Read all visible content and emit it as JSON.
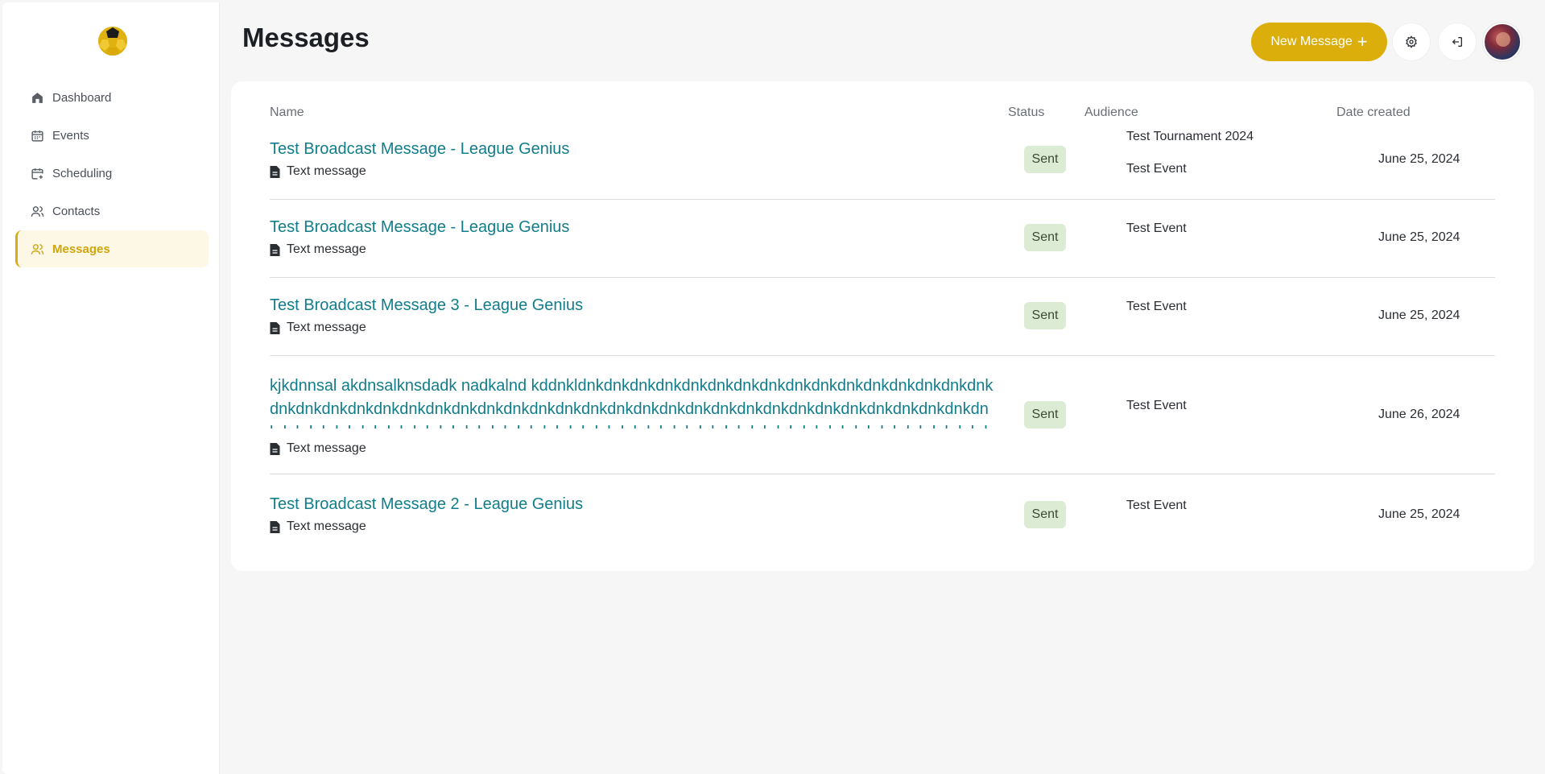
{
  "sidebar": {
    "items": [
      {
        "label": "Dashboard",
        "icon": "home-icon",
        "active": false
      },
      {
        "label": "Events",
        "icon": "calendar-icon",
        "active": false
      },
      {
        "label": "Scheduling",
        "icon": "calendar-plus-icon",
        "active": false
      },
      {
        "label": "Contacts",
        "icon": "users-icon",
        "active": false
      },
      {
        "label": "Messages",
        "icon": "users-icon",
        "active": true
      }
    ]
  },
  "header": {
    "title": "Messages",
    "new_button_label": "New Message",
    "new_button_icon": "plus-icon",
    "settings_icon": "gear-icon",
    "logout_icon": "logout-icon"
  },
  "table": {
    "columns": {
      "name": "Name",
      "status": "Status",
      "audience": "Audience",
      "date": "Date created"
    },
    "rows": [
      {
        "title": "Test Broadcast Message - League Genius",
        "type": "Text message",
        "status": "Sent",
        "audience": [
          "Test Tournament 2024",
          "Test Event"
        ],
        "date": "June 25, 2024"
      },
      {
        "title": "Test Broadcast Message - League Genius",
        "type": "Text message",
        "status": "Sent",
        "audience": [
          "Test Event"
        ],
        "date": "June 25, 2024"
      },
      {
        "title": "Test Broadcast Message 3 - League Genius",
        "type": "Text message",
        "status": "Sent",
        "audience": [
          "Test Event"
        ],
        "date": "June 25, 2024"
      },
      {
        "title": "kjkdnnsal akdnsalknsdadk nadkalnd kddnkldnkdnkdnkdnkdnkdnkdnkdnkdnkdnkdnkdnkdnkdnkdnkdnkdnkdnkdnkdnkdnkdnkdnkdnkdnkdnkdnkdnkdnkdnkdnkdnkdnkdnkdnkdnkdnkdnkdnkdnkdnkdnkdnkdnkdnkdnkdnkdnkdnkdnkdnkdnkdnkdnkdnkdnkdnkdnkdnkdnkdnkdnkdnkdnkdnkdnkdnkdnkdnkdnkdnkdnkdnkdnkdnkdnkdnkdnkdnkdnkdnkdnkdnkdnkdnkdnkdnkd",
        "type": "Text message",
        "status": "Sent",
        "audience": [
          "Test Event"
        ],
        "date": "June 26, 2024"
      },
      {
        "title": "Test Broadcast Message 2 - League Genius",
        "type": "Text message",
        "status": "Sent",
        "audience": [
          "Test Event"
        ],
        "date": "June 25, 2024"
      }
    ]
  },
  "colors": {
    "accent": "#dbae0c",
    "link": "#127d8a",
    "badge_bg": "#dcebd3"
  }
}
